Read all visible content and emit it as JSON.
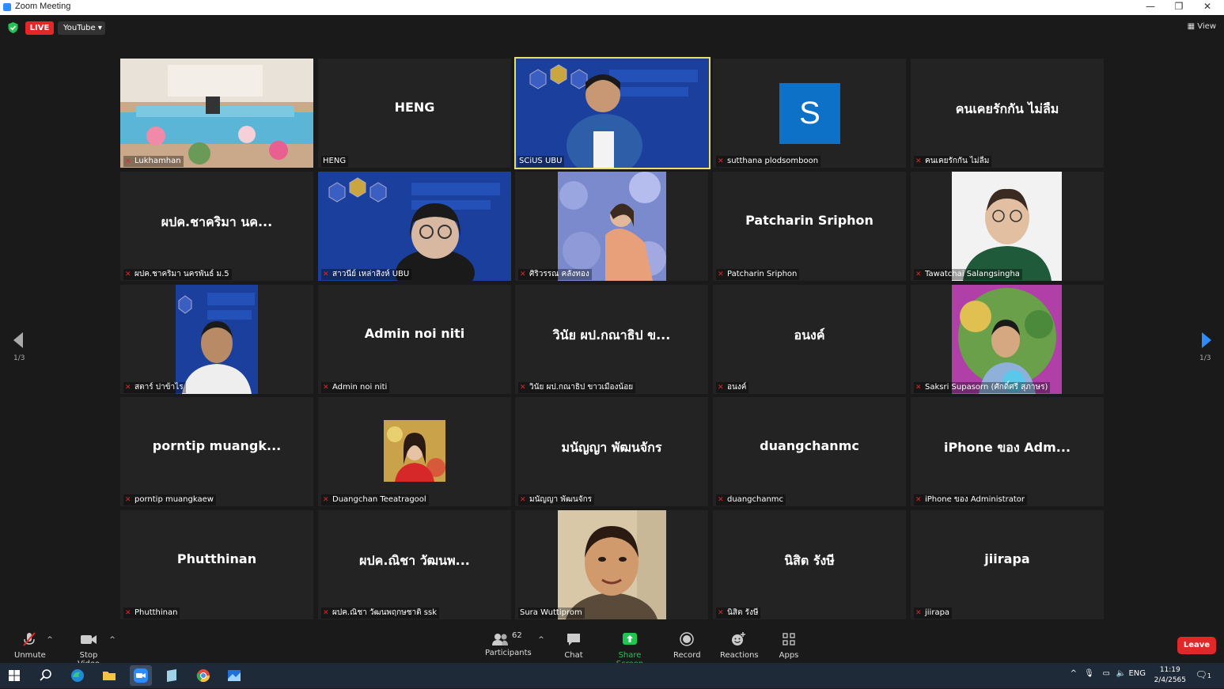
{
  "window": {
    "title": "Zoom Meeting",
    "minimize": "—",
    "restore": "❐",
    "close": "✕"
  },
  "topbar": {
    "live_label": "LIVE",
    "stream_label": "YouTube ▾",
    "view_label": "View"
  },
  "pager": {
    "left": "1/3",
    "right": "1/3"
  },
  "tiles": [
    {
      "label": "Lukhamhan"
    },
    {
      "name": "HENG",
      "label": "HENG"
    },
    {
      "label": "SCiUS UBU"
    },
    {
      "label": "sutthana plodsomboon",
      "avatar_letter": "S"
    },
    {
      "name": "คนเคยรักกัน ไม่ลืม",
      "label": "คนเคยรักกัน ไม่ลืม"
    },
    {
      "name": "ผปค.ชาคริมา นค...",
      "label": "ผปค.ชาคริมา นครพันธ์ ม.5"
    },
    {
      "label": "สาวนีย์ เหล่าสิงห์ UBU"
    },
    {
      "label": "ศิริวรรณ คลังทอง"
    },
    {
      "name": "Patcharin Sriphon",
      "label": "Patcharin Sriphon"
    },
    {
      "label": "Tawatchai Salangsingha"
    },
    {
      "label": "สตาร์ ปาข้าไร"
    },
    {
      "name": "Admin noi niti",
      "label": "Admin noi niti"
    },
    {
      "name": "วินัย ผป.กณาธิป ข...",
      "label": "วินัย ผป.กณาธิป ขาวเมืองน้อย"
    },
    {
      "name": "อนงค์",
      "label": "อนงค์"
    },
    {
      "label": "Saksri Supasorn (ศักดิ์ศรี สุภาษร)"
    },
    {
      "name": "porntip  muangk...",
      "label": "porntip muangkaew"
    },
    {
      "label": "Duangchan Teeatragool"
    },
    {
      "name": "มนัญญา พัฒนจักร",
      "label": "มนัญญา พัฒนจักร"
    },
    {
      "name": "duangchanmc",
      "label": "duangchanmc"
    },
    {
      "name": "iPhone ของ Adm...",
      "label": "iPhone ของ Administrator"
    },
    {
      "name": "Phutthinan",
      "label": "Phutthinan"
    },
    {
      "name": "ผปค.ณิชา วัฒนพ...",
      "label": "ผปค.ณิชา วัฒนพฤกษชาติ ssk"
    },
    {
      "label": "Sura Wuttiprom"
    },
    {
      "name": "นิสิต รังษี",
      "label": "นิสิต รังษี"
    },
    {
      "name": "jiirapa",
      "label": "jiirapa"
    }
  ],
  "controls": {
    "unmute": "Unmute",
    "stop_video": "Stop Video",
    "participants": "Participants",
    "participants_count": "62",
    "chat": "Chat",
    "share_screen": "Share Screen",
    "record": "Record",
    "reactions": "Reactions",
    "apps": "Apps",
    "leave": "Leave"
  },
  "taskbar": {
    "lang": "ENG",
    "time": "11:19",
    "date": "2/4/2565",
    "notif_count": "1"
  },
  "colors": {
    "live": "#e02828",
    "share": "#23c552",
    "active_speaker": "#e6e06a",
    "avatar": "#0e71c8"
  }
}
